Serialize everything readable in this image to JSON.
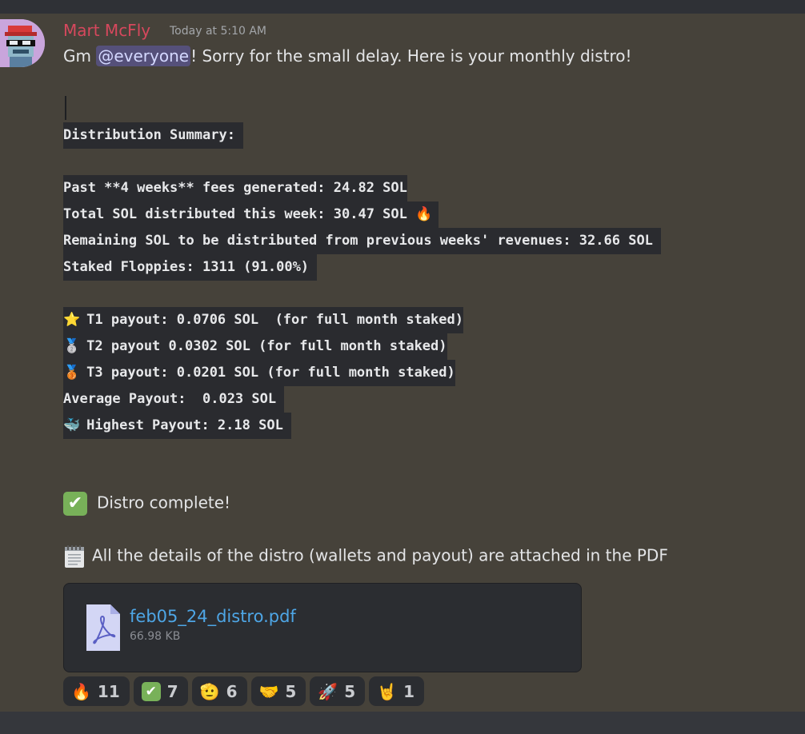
{
  "message": {
    "author": "Mart McFly",
    "timestamp": "Today at 5:10 AM",
    "greeting_prefix": "Gm ",
    "mention": "@everyone",
    "greeting_suffix": "! Sorry for the small delay. Here is your monthly distro!"
  },
  "code_block": {
    "summary_heading": "Distribution Summary: ",
    "fees_line": "Past **4 weeks** fees generated: 24.82 SOL",
    "distributed_line": "Total SOL distributed this week: 30.47 SOL ",
    "remaining_line": "Remaining SOL to be distributed from previous weeks' revenues: 32.66 SOL ",
    "staked_line": "Staked Floppies: 1311 (91.00%) ",
    "t1_line": "T1 payout: 0.0706 SOL  (for full month staked)",
    "t2_line": "T2 payout 0.0302 SOL (for full month staked)",
    "t3_line": "T3 payout: 0.0201 SOL (for full month staked)",
    "average_line": "Average Payout:  0.023 SOL ",
    "highest_line": "Highest Payout: 2.18 SOL "
  },
  "emoji": {
    "fire": "🔥",
    "star": "⭐",
    "silver": "🥈",
    "bronze": "🥉",
    "whale": "🐳",
    "check": "✔"
  },
  "distro_complete": "Distro complete!",
  "details_text": "All the details of the distro (wallets and payout) are attached in the PDF",
  "attachment": {
    "file_name": "feb05_24_distro.pdf",
    "file_size": "66.98 KB"
  },
  "reactions": [
    {
      "emoji": "🔥",
      "count": "11"
    },
    {
      "emoji": "✔",
      "count": "7"
    },
    {
      "emoji": "🫡",
      "count": "6"
    },
    {
      "emoji": "🤝",
      "count": "5"
    },
    {
      "emoji": "🚀",
      "count": "5"
    },
    {
      "emoji": "🤘",
      "count": "1"
    }
  ]
}
